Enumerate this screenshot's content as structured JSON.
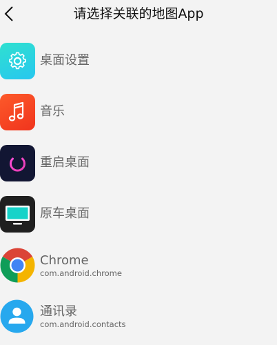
{
  "header": {
    "title": "请选择关联的地图App"
  },
  "apps": [
    {
      "name": "桌面设置",
      "package": "",
      "icon": "gear-icon",
      "color": "#2bd4e0"
    },
    {
      "name": "音乐",
      "package": "",
      "icon": "music-note-icon",
      "color": "#f6421f"
    },
    {
      "name": "重启桌面",
      "package": "",
      "icon": "power-icon",
      "color": "#121633"
    },
    {
      "name": "原车桌面",
      "package": "",
      "icon": "monitor-icon",
      "color": "#1f1f1f"
    },
    {
      "name": "Chrome",
      "package": "com.android.chrome",
      "icon": "chrome-icon",
      "color": "#4285f4"
    },
    {
      "name": "通讯录",
      "package": "com.android.contacts",
      "icon": "contact-person-icon",
      "color": "#27a8ee"
    }
  ]
}
